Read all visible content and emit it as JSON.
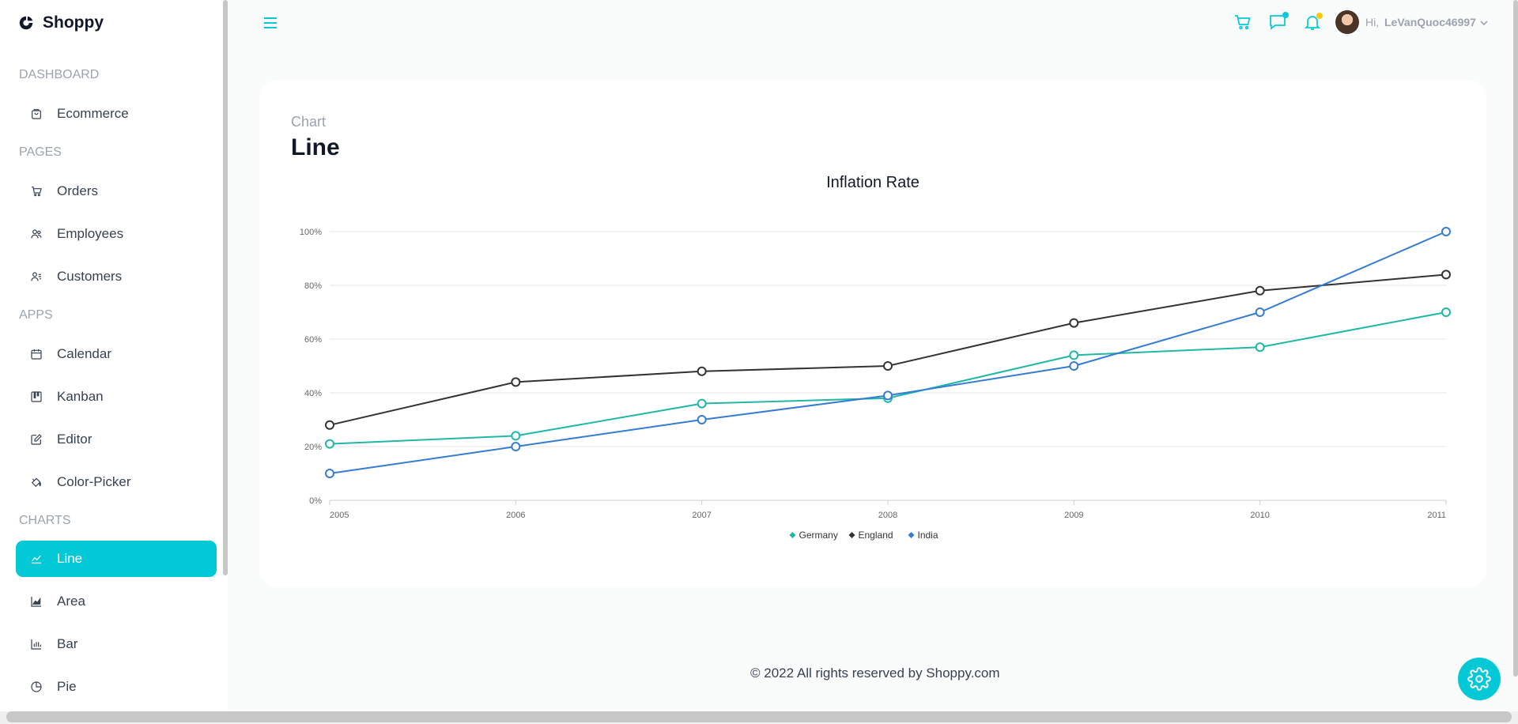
{
  "brand": {
    "name": "Shoppy"
  },
  "sidebar": {
    "sections": [
      {
        "title": "Dashboard",
        "items": [
          {
            "label": "Ecommerce",
            "icon": "shopping-bag-icon"
          }
        ]
      },
      {
        "title": "Pages",
        "items": [
          {
            "label": "Orders",
            "icon": "cart-icon"
          },
          {
            "label": "Employees",
            "icon": "users-icon"
          },
          {
            "label": "Customers",
            "icon": "user-list-icon"
          }
        ]
      },
      {
        "title": "Apps",
        "items": [
          {
            "label": "Calendar",
            "icon": "calendar-icon"
          },
          {
            "label": "Kanban",
            "icon": "kanban-icon"
          },
          {
            "label": "Editor",
            "icon": "edit-icon"
          },
          {
            "label": "Color-Picker",
            "icon": "paint-bucket-icon"
          }
        ]
      },
      {
        "title": "Charts",
        "items": [
          {
            "label": "Line",
            "icon": "line-chart-icon",
            "active": true
          },
          {
            "label": "Area",
            "icon": "area-chart-icon"
          },
          {
            "label": "Bar",
            "icon": "bar-chart-icon"
          },
          {
            "label": "Pie",
            "icon": "pie-chart-icon"
          }
        ]
      }
    ]
  },
  "navbar": {
    "greeting": "Hi,",
    "username": "LeVanQuoc46997",
    "icons": [
      "menu-icon",
      "cart-icon",
      "chat-icon",
      "bell-icon"
    ],
    "accent": "#03c9d7",
    "chat_dot_color": "#03c9d7",
    "bell_dot_color": "#fec90f"
  },
  "page": {
    "category": "Chart",
    "title": "Line"
  },
  "chart_data": {
    "type": "line",
    "title": "Inflation Rate",
    "x": [
      "2005",
      "2006",
      "2007",
      "2008",
      "2009",
      "2010",
      "2011"
    ],
    "ylim": [
      0,
      100
    ],
    "yticks": [
      "0%",
      "20%",
      "40%",
      "60%",
      "80%",
      "100%"
    ],
    "grid": true,
    "legend_position": "bottom",
    "series": [
      {
        "name": "Germany",
        "color": "#1fb7a6",
        "values": [
          21,
          24,
          36,
          38,
          54,
          57,
          70
        ]
      },
      {
        "name": "England",
        "color": "#333333",
        "values": [
          28,
          44,
          48,
          50,
          66,
          78,
          84
        ]
      },
      {
        "name": "India",
        "color": "#357cd2",
        "values": [
          10,
          20,
          30,
          39,
          50,
          70,
          100
        ]
      }
    ]
  },
  "footer": {
    "text": "© 2022 All rights reserved by Shoppy.com"
  }
}
